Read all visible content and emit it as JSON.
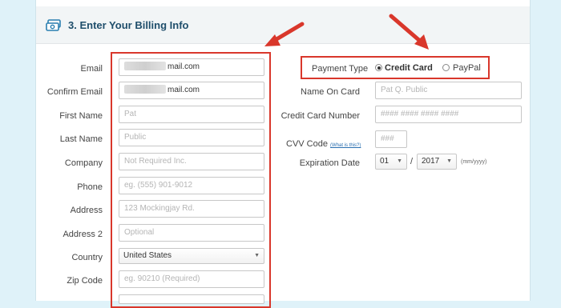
{
  "header": {
    "title": "3. Enter Your Billing Info",
    "icon": "billing-cash-icon"
  },
  "accent_color": "#d9372b",
  "left_form": [
    {
      "key": "email",
      "label": "Email",
      "value": "mail.com",
      "placeholder": "",
      "redacted_prefix": true
    },
    {
      "key": "confirm_email",
      "label": "Confirm Email",
      "value": "mail.com",
      "placeholder": "",
      "redacted_prefix": true
    },
    {
      "key": "first_name",
      "label": "First Name",
      "value": "",
      "placeholder": "Pat"
    },
    {
      "key": "last_name",
      "label": "Last Name",
      "value": "",
      "placeholder": "Public"
    },
    {
      "key": "company",
      "label": "Company",
      "value": "",
      "placeholder": "Not Required Inc."
    },
    {
      "key": "phone",
      "label": "Phone",
      "value": "",
      "placeholder": "eg. (555) 901-9012"
    },
    {
      "key": "address",
      "label": "Address",
      "value": "",
      "placeholder": "123 Mockingjay Rd."
    },
    {
      "key": "address2",
      "label": "Address 2",
      "value": "",
      "placeholder": "Optional"
    },
    {
      "key": "country",
      "label": "Country",
      "value": "United States",
      "placeholder": ""
    },
    {
      "key": "zip",
      "label": "Zip Code",
      "value": "",
      "placeholder": "eg. 90210 (Required)"
    }
  ],
  "payment": {
    "type_label": "Payment Type",
    "option_credit": "Credit Card",
    "option_paypal": "PayPal",
    "selected": "Credit Card"
  },
  "right_form": {
    "name_on_card_label": "Name On Card",
    "name_on_card_placeholder": "Pat Q. Public",
    "card_number_label": "Credit Card Number",
    "card_number_placeholder": "#### #### #### ####",
    "cvv_label": "CVV Code",
    "cvv_help_link": "(What is this?)",
    "cvv_placeholder": "###",
    "expiration_label": "Expiration Date",
    "exp_month": "01",
    "exp_separator": "/",
    "exp_year": "2017",
    "exp_format_hint": "(mm/yyyy)"
  }
}
